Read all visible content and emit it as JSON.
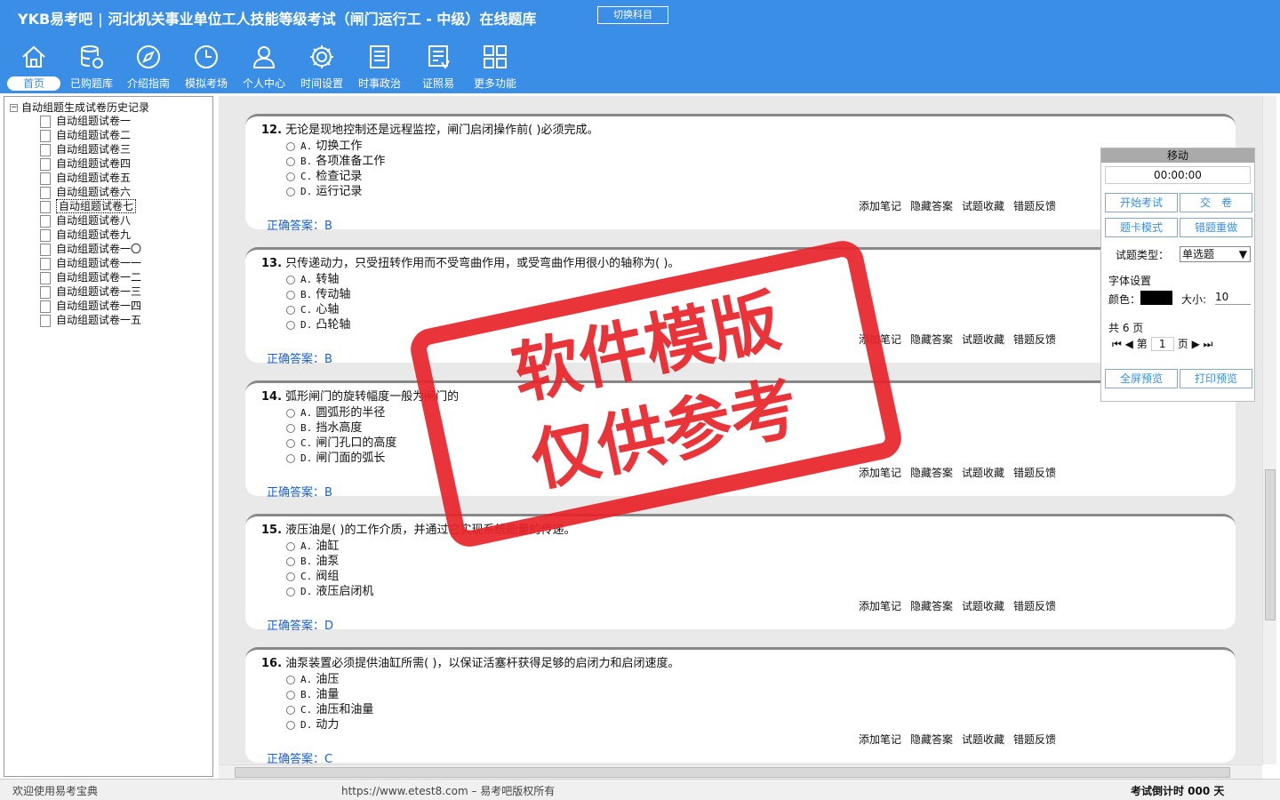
{
  "header": {
    "brand": "YKB易考吧",
    "title": "河北机关事业单位工人技能等级考试（闸门运行工 - 中级）在线题库",
    "switch_label": "切换科目"
  },
  "nav": [
    {
      "label": "首页",
      "icon": "home-icon"
    },
    {
      "label": "已购题库",
      "icon": "database-icon"
    },
    {
      "label": "介绍指南",
      "icon": "compass-icon"
    },
    {
      "label": "模拟考场",
      "icon": "clock-icon"
    },
    {
      "label": "个人中心",
      "icon": "user-icon"
    },
    {
      "label": "时间设置",
      "icon": "gear-icon"
    },
    {
      "label": "时事政治",
      "icon": "news-icon"
    },
    {
      "label": "证照易",
      "icon": "certificate-icon"
    },
    {
      "label": "更多功能",
      "icon": "grid-icon"
    }
  ],
  "tree": {
    "root": "自动组题生成试卷历史记录",
    "items": [
      "自动组题试卷一",
      "自动组题试卷二",
      "自动组题试卷三",
      "自动组题试卷四",
      "自动组题试卷五",
      "自动组题试卷六",
      "自动组题试卷七",
      "自动组题试卷八",
      "自动组题试卷九",
      "自动组题试卷一〇",
      "自动组题试卷一一",
      "自动组题试卷一二",
      "自动组题试卷一三",
      "自动组题试卷一四",
      "自动组题试卷一五"
    ]
  },
  "questions": [
    {
      "num": "12.",
      "text": "无论是现地控制还是远程监控，闸门启闭操作前( )必须完成。",
      "options": [
        {
          "letter": "A.",
          "text": "切换工作"
        },
        {
          "letter": "B.",
          "text": "各项准备工作"
        },
        {
          "letter": "C.",
          "text": "检查记录"
        },
        {
          "letter": "D.",
          "text": "运行记录"
        }
      ],
      "answer_label": "正确答案：",
      "answer": "B"
    },
    {
      "num": "13.",
      "text": "只传递动力，只受扭转作用而不受弯曲作用，或受弯曲作用很小的轴称为( )。",
      "options": [
        {
          "letter": "A.",
          "text": "转轴"
        },
        {
          "letter": "B.",
          "text": "传动轴"
        },
        {
          "letter": "C.",
          "text": "心轴"
        },
        {
          "letter": "D.",
          "text": "凸轮轴"
        }
      ],
      "answer_label": "正确答案：",
      "answer": "B"
    },
    {
      "num": "14.",
      "text": "弧形闸门的旋转幅度一般为闸门的",
      "options": [
        {
          "letter": "A.",
          "text": "圆弧形的半径"
        },
        {
          "letter": "B.",
          "text": "挡水高度"
        },
        {
          "letter": "C.",
          "text": "闸门孔口的高度"
        },
        {
          "letter": "D.",
          "text": "闸门面的弧长"
        }
      ],
      "answer_label": "正确答案：",
      "answer": "B"
    },
    {
      "num": "15.",
      "text": "液压油是( )的工作介质，并通过它实现系统能量的传递。",
      "options": [
        {
          "letter": "A.",
          "text": "油缸"
        },
        {
          "letter": "B.",
          "text": "油泵"
        },
        {
          "letter": "C.",
          "text": "阀组"
        },
        {
          "letter": "D.",
          "text": "液压启闭机"
        }
      ],
      "answer_label": "正确答案：",
      "answer": "D"
    },
    {
      "num": "16.",
      "text": "油泵装置必须提供油缸所需( )，以保证活塞杆获得足够的启闭力和启闭速度。",
      "options": [
        {
          "letter": "A.",
          "text": "油压"
        },
        {
          "letter": "B.",
          "text": "油量"
        },
        {
          "letter": "C.",
          "text": "油压和油量"
        },
        {
          "letter": "D.",
          "text": "动力"
        }
      ],
      "answer_label": "正确答案：",
      "answer": "C"
    }
  ],
  "actions": {
    "note": "添加笔记",
    "hide": "隐藏答案",
    "fav": "试题收藏",
    "report": "错题反馈"
  },
  "panel": {
    "title": "移动",
    "timer": "00:00:00",
    "start": "开始考试",
    "submit": "交　卷",
    "card_mode": "题卡模式",
    "redo": "错题重做",
    "type_label": "试题类型：",
    "type_value": "单选题",
    "font_label": "字体设置",
    "color_label": "颜色：",
    "size_label": "大小:",
    "size_value": "10",
    "pages_label": "共 6 页",
    "page_prefix": "第",
    "page_value": "1",
    "page_suffix": "页",
    "fullscreen": "全屏预览",
    "print": "打印预览"
  },
  "stamp": {
    "line1": "软件模版",
    "line2": "仅供参考"
  },
  "status": {
    "welcome": "欢迎使用易考宝典",
    "copyright": "https://www.etest8.com – 易考吧版权所有",
    "countdown": "考试倒计时 000 天"
  }
}
